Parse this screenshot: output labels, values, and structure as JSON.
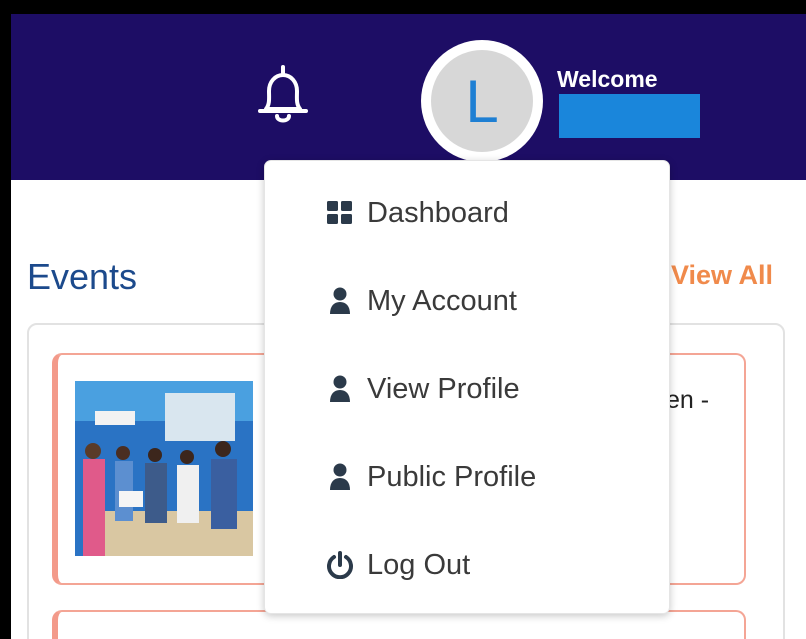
{
  "header": {
    "welcome_label": "Welcome",
    "avatar_initial": "L",
    "bell_icon": "bell-icon",
    "colors": {
      "header_bg": "#1d0d65",
      "avatar_text": "#1e7fd3",
      "redacted_name": "#1a86db"
    }
  },
  "user_menu": {
    "items": [
      {
        "label": "Dashboard",
        "icon": "grid-icon"
      },
      {
        "label": "My Account",
        "icon": "user-icon"
      },
      {
        "label": "View Profile",
        "icon": "user-icon"
      },
      {
        "label": "Public Profile",
        "icon": "user-icon"
      },
      {
        "label": "Log Out",
        "icon": "power-icon"
      }
    ]
  },
  "events": {
    "title": "Events",
    "view_all_label": "View All",
    "cards": [
      {
        "title_visible_fragment": "en -"
      }
    ],
    "colors": {
      "title": "#1c4a8c",
      "view_all": "#f08a4b",
      "card_border": "#f4a595"
    }
  }
}
